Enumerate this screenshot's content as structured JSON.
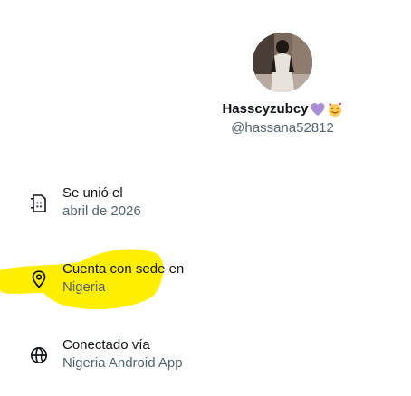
{
  "profile": {
    "display_name": "Hasscyzubcy",
    "emojis": [
      "purple-heart",
      "smiling-face-with-hearts"
    ],
    "handle": "@hassana52812"
  },
  "about": {
    "joined": {
      "label": "Se unió el",
      "value": "abril de 2026",
      "icon": "calendar-icon"
    },
    "location": {
      "label": "Cuenta con sede en",
      "value": "Nigeria",
      "icon": "location-pin-icon"
    },
    "connected": {
      "label": "Conectado vía",
      "value": "Nigeria Android App",
      "icon": "globe-icon"
    }
  },
  "colors": {
    "text_primary": "#0f1419",
    "text_secondary": "#536471",
    "highlight": "#ffee00",
    "background": "#ffffff"
  }
}
